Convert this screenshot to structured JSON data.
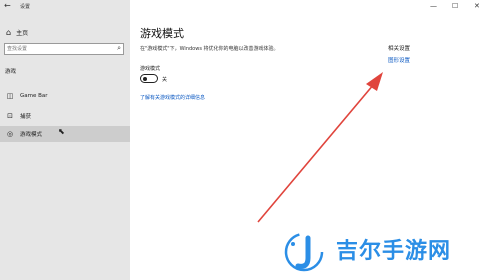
{
  "window": {
    "back_icon": "back-arrow-icon",
    "title": "设置",
    "controls": [
      "—",
      "☐",
      "✕"
    ]
  },
  "sidebar": {
    "home_label": "主页",
    "search_placeholder": "查找设置",
    "section_label": "游戏",
    "items": [
      {
        "label": "Game Bar",
        "icon": "game-bar-icon"
      },
      {
        "label": "捕获",
        "icon": "capture-icon"
      },
      {
        "label": "游戏模式",
        "icon": "game-mode-icon",
        "active": true
      }
    ]
  },
  "main": {
    "title": "游戏模式",
    "description": "在\"游戏模式\"下，Windows 将优化你的电脑以改善游戏体验。",
    "toggle_label": "游戏模式",
    "toggle_state": "关",
    "toggle_on": false,
    "link": "了解有关游戏模式的详细信息"
  },
  "related": {
    "title": "相关设置",
    "link": "图形设置"
  },
  "colors": {
    "sidebar_bg": "#e6e6e6",
    "active_item_bg": "#cdcdcd",
    "link": "#0a58c2",
    "annotation_arrow": "#e0443c",
    "watermark": "#2b8ee6"
  },
  "watermark": {
    "text": "吉尔手游网"
  }
}
